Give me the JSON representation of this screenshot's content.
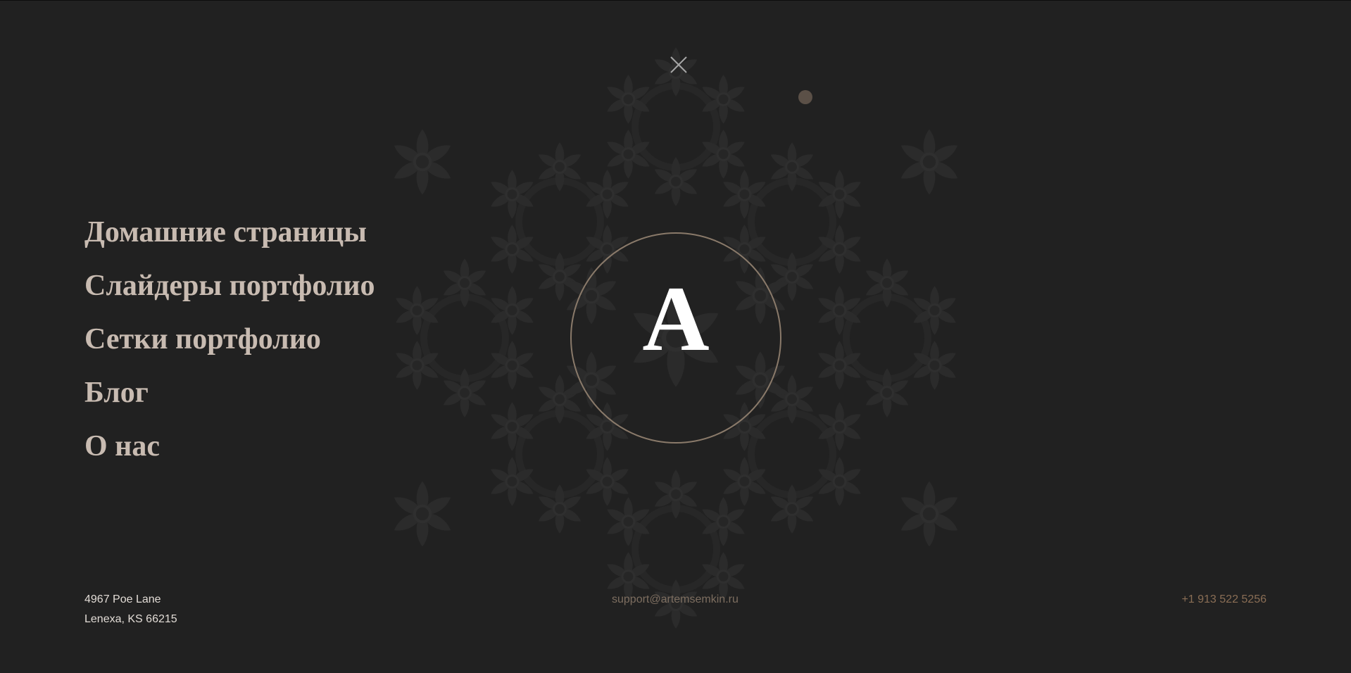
{
  "menu": {
    "items": [
      {
        "label": "Домашние страницы"
      },
      {
        "label": "Слайдеры портфолио"
      },
      {
        "label": "Сетки портфолио"
      },
      {
        "label": "Блог"
      },
      {
        "label": "О нас"
      }
    ]
  },
  "logo": {
    "letter": "A"
  },
  "contact": {
    "address_line1": "4967 Poe Lane",
    "address_line2": "Lenexa, KS 66215",
    "email": "support@artemsemkin.ru",
    "phone": "+1 913 522 5256"
  },
  "icons": {
    "close": "close-icon",
    "ornament": "floral-ornament"
  },
  "colors": {
    "background": "#212121",
    "menu_text": "#c8bbb1",
    "accent": "#8a6e55",
    "ring": "#8a7a6a"
  }
}
